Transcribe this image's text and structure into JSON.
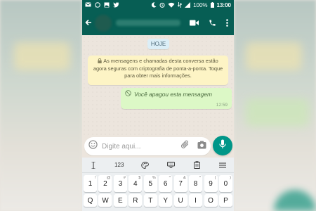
{
  "status_bar": {
    "battery": "100%",
    "time": "13:00",
    "left_icons": [
      "mail-icon",
      "whatsapp-icon",
      "gallery-icon",
      "twitter-icon"
    ],
    "right_icons": [
      "moon-icon",
      "alarm-icon",
      "wifi-icon",
      "data-icon",
      "signal-icon",
      "battery-icon"
    ]
  },
  "app_bar": {
    "back_icon": "back-arrow-icon",
    "actions": [
      "video-call-icon",
      "phone-call-icon",
      "more-vert-icon"
    ]
  },
  "chat": {
    "date_chip": "HOJE",
    "encryption_notice": "As mensagens e chamadas desta conversa estão agora seguras com criptografia de ponta-a-ponta. Toque para obter mais informações.",
    "message": {
      "text": "Você apagou esta mensagem",
      "time": "12:59"
    }
  },
  "composer": {
    "placeholder": "Digite aqui...",
    "emoji_icon": "emoji-icon",
    "attach_icon": "paperclip-icon",
    "camera_icon": "camera-icon",
    "mic_icon": "mic-icon"
  },
  "keyboard": {
    "toolbar": {
      "numbers_label": "123"
    },
    "number_row": [
      {
        "main": "1",
        "sub": "!"
      },
      {
        "main": "2",
        "sub": "@"
      },
      {
        "main": "3",
        "sub": "#"
      },
      {
        "main": "4",
        "sub": "$"
      },
      {
        "main": "5",
        "sub": "%"
      },
      {
        "main": "6",
        "sub": "^"
      },
      {
        "main": "7",
        "sub": "&"
      },
      {
        "main": "8",
        "sub": "*"
      },
      {
        "main": "9",
        "sub": "("
      },
      {
        "main": "0",
        "sub": ")"
      }
    ],
    "letter_row": [
      "Q",
      "W",
      "E",
      "R",
      "T",
      "Y",
      "U",
      "I",
      "O",
      "P"
    ]
  },
  "colors": {
    "header": "#075e54",
    "accent": "#009688",
    "outgoing_bubble": "#dcf8c6",
    "notice": "#fdf4c5"
  }
}
